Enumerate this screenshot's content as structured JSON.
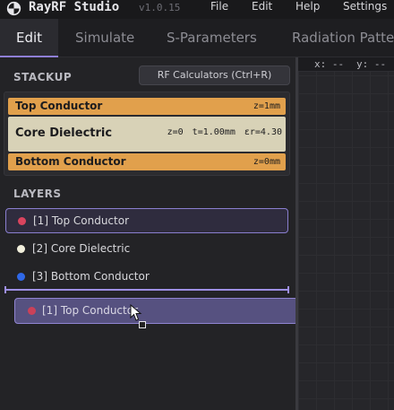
{
  "app": {
    "name": "RayRF Studio",
    "version": "v1.0.15"
  },
  "menu": [
    "File",
    "Edit",
    "Help",
    "Settings"
  ],
  "tabs": [
    {
      "label": "Edit",
      "active": true
    },
    {
      "label": "Simulate",
      "active": false
    },
    {
      "label": "S-Parameters",
      "active": false
    },
    {
      "label": "Radiation Patter",
      "active": false
    }
  ],
  "stackup": {
    "title": "STACKUP",
    "rf_button": "RF Calculators (Ctrl+R)",
    "layers": [
      {
        "name": "Top Conductor",
        "z": "z=1mm",
        "color": "#e1a04c"
      },
      {
        "name": "Core Dielectric",
        "z": "z=0",
        "t": "t=1.00mm",
        "er": "εr=4.30",
        "color": "#d8d2b7"
      },
      {
        "name": "Bottom Conductor",
        "z": "z=0mm",
        "color": "#e1a04c"
      }
    ]
  },
  "layers": {
    "title": "LAYERS",
    "items": [
      {
        "label": "[1] Top Conductor",
        "dot": "#d9445e",
        "selected": true
      },
      {
        "label": "[2] Core Dielectric",
        "dot": "#f1efdc",
        "selected": false
      },
      {
        "label": "[3] Bottom Conductor",
        "dot": "#2f68e8",
        "selected": false
      }
    ],
    "dragging": {
      "label": "[1] Top Conductor",
      "dot": "#d9445e"
    }
  },
  "canvas": {
    "x_label": "x: --",
    "y_label": "y: --"
  },
  "colors": {
    "accent": "#8f7fd6",
    "conductor": "#e1a04c",
    "dielectric": "#d8d2b7"
  }
}
